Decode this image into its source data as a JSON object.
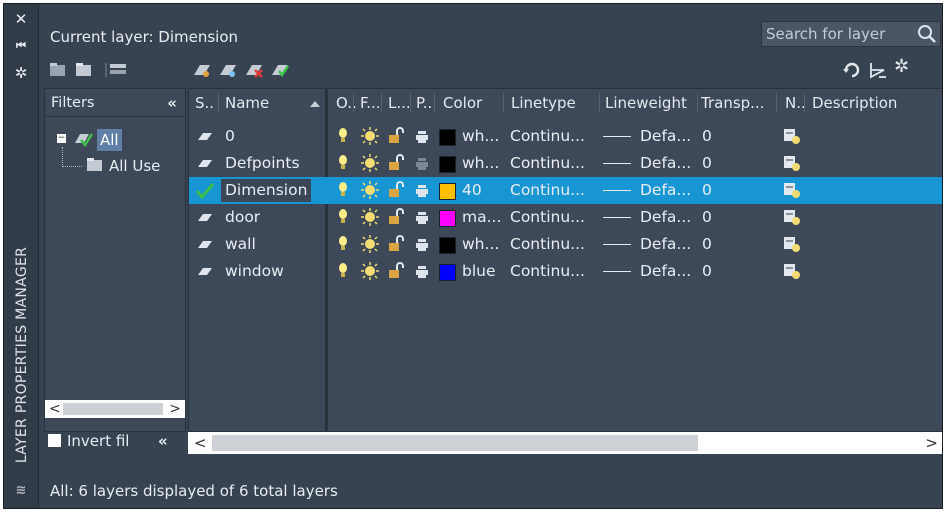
{
  "panel": {
    "vertical_title": "LAYER PROPERTIES MANAGER",
    "current_layer": "Current layer: Dimension",
    "search_placeholder": "Search for layer",
    "status": "All: 6 layers displayed of 6 total layers",
    "collapse_glyph": "«"
  },
  "filters": {
    "header": "Filters",
    "tree": [
      {
        "label": "All",
        "selected": true
      },
      {
        "label": "All Use"
      }
    ],
    "invert_label": "Invert fil",
    "invert_checked": false
  },
  "columns": [
    "S..",
    "Name",
    "O..",
    "F...",
    "L...",
    "P..",
    "Color",
    "Linetype",
    "Lineweight",
    "Transp...",
    "N..",
    "Description"
  ],
  "layers": [
    {
      "name": "0",
      "color_name": "wh...",
      "color_hex": "#000000",
      "linetype": "Continu...",
      "lineweight": "Defa...",
      "transparency": "0",
      "current": false,
      "selected": false
    },
    {
      "name": "Defpoints",
      "color_name": "wh...",
      "color_hex": "#000000",
      "linetype": "Continu...",
      "lineweight": "Defa...",
      "transparency": "0",
      "current": false,
      "selected": false
    },
    {
      "name": "Dimension",
      "color_name": "40",
      "color_hex": "#ffbf00",
      "linetype": "Continu...",
      "lineweight": "Defa...",
      "transparency": "0",
      "current": true,
      "selected": true
    },
    {
      "name": "door",
      "color_name": "ma...",
      "color_hex": "#ff00ff",
      "linetype": "Continu...",
      "lineweight": "Defa...",
      "transparency": "0",
      "current": false,
      "selected": false
    },
    {
      "name": "wall",
      "color_name": "wh...",
      "color_hex": "#000000",
      "linetype": "Continu...",
      "lineweight": "Defa...",
      "transparency": "0",
      "current": false,
      "selected": false
    },
    {
      "name": "window",
      "color_name": "blue",
      "color_hex": "#0000ff",
      "linetype": "Continu...",
      "lineweight": "Defa...",
      "transparency": "0",
      "current": false,
      "selected": false
    }
  ],
  "colors": {
    "background": "#384352",
    "selection": "#1896d4",
    "bulb": "#ffef8a",
    "sun": "#f3dd72",
    "lock": "#d9a441"
  }
}
